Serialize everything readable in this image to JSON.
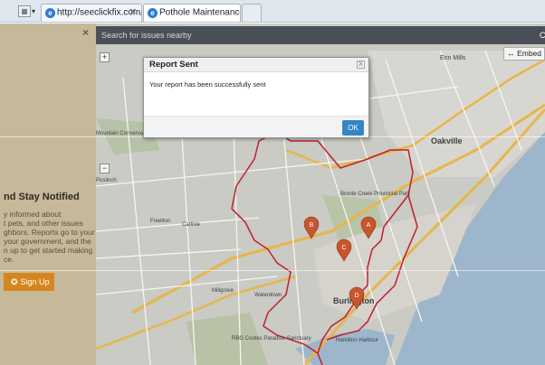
{
  "browser": {
    "tab1_url": "http://seeclickfix.com/...",
    "tab2_title": "Pothole Maintenance",
    "tab_close": "✕"
  },
  "left_panel": {
    "close": "×",
    "title": "nd Stay Notified",
    "body_lines": [
      "y informed about",
      "t pets, and other issues",
      "ghbors. Reports go to your",
      "your government, and the",
      "n up to get started making",
      "ce."
    ],
    "signup_label": "Sign Up"
  },
  "map": {
    "search_placeholder": "Search for issues nearby",
    "search_trailing": "C",
    "embed_label": "↔ Embed",
    "zoom_in": "+",
    "zoom_out": "−",
    "place_labels": [
      {
        "text": "Erin Mills"
      },
      {
        "text": "Oakville"
      },
      {
        "text": "Bronte Creek Provincial Park"
      },
      {
        "text": "Burlington"
      },
      {
        "text": "Millgrove"
      },
      {
        "text": "Waterdown"
      },
      {
        "text": "Mountain Conservation Area"
      },
      {
        "text": "Puslinch"
      },
      {
        "text": "Freelton"
      },
      {
        "text": "Carlisle"
      },
      {
        "text": "Hamilton Harbour"
      },
      {
        "text": "RBG Cootes Paradise Sanctuary"
      }
    ],
    "markers": [
      {
        "label": "A",
        "color": "#c9552e"
      },
      {
        "label": "B",
        "color": "#c9552e"
      },
      {
        "label": "C",
        "color": "#c9552e"
      },
      {
        "label": "D",
        "color": "#c9552e"
      }
    ]
  },
  "modal": {
    "title": "Report Sent",
    "message": "Your report has been successfully sent",
    "ok_label": "OK",
    "close": "X"
  }
}
